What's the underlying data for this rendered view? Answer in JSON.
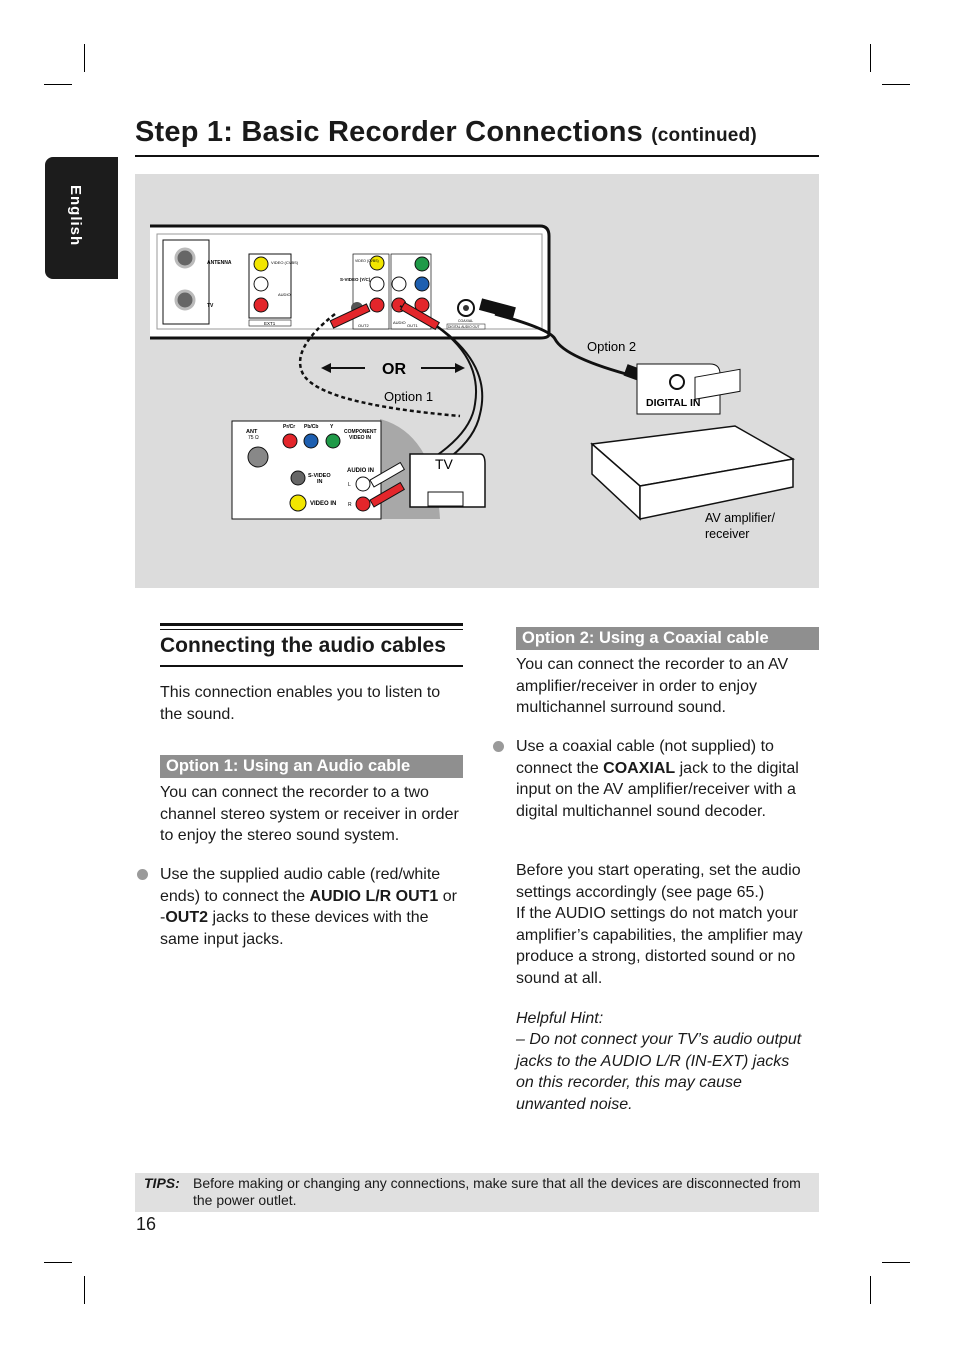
{
  "header": {
    "title": "Step 1: Basic Recorder Connections",
    "continued": "(continued)"
  },
  "language_tab": "English",
  "diagram": {
    "recorder_labels": {
      "antenna": "ANTENNA",
      "tv": "TV",
      "ext1": "EXT1",
      "ext1_video": "VIDEO (CVBS)",
      "ext1_audio": "AUDIO",
      "out2_video": "VIDEO (CVBS)",
      "svideo": "S-VIDEO (Y/C)",
      "out2": "OUT2",
      "audio": "AUDIO",
      "out1": "OUT1",
      "coaxial": "COAXIAL",
      "digital_audio_out": "DIGITAL AUDIO OUT"
    },
    "or_label": "OR",
    "option1_label": "Option 1",
    "option2_label": "Option 2",
    "digital_in_label": "DIGITAL IN",
    "tv_label": "TV",
    "tv_panel": {
      "ant": "ANT",
      "ohm": "75 Ω",
      "pr": "Pr/Cr",
      "pb": "Pb/Cb",
      "y": "Y",
      "component": "COMPONENT",
      "video_in_c": "VIDEO IN",
      "svideo_in": "S-VIDEO",
      "in": "IN",
      "audio_in": "AUDIO IN",
      "l": "L",
      "r": "R",
      "video_in": "VIDEO IN"
    },
    "amp_label_1": "AV amplifier/",
    "amp_label_2": "receiver",
    "colors": {
      "yellow": "#f2e600",
      "red": "#e3262b",
      "green": "#1f9a48",
      "blue": "#1e5fb0",
      "background": "#dcdcdc"
    }
  },
  "left": {
    "heading": "Connecting the audio cables",
    "intro": "This connection enables you to listen to the sound.",
    "option_bar": "Option 1: Using an Audio cable",
    "option_text": "You can connect the recorder to a two channel stereo system or receiver in order to enjoy the stereo sound system.",
    "bullet": {
      "p1": "Use the supplied audio cable (red/white ends) to connect the ",
      "b1": "AUDIO L/R OUT1",
      "p2": " or -",
      "b2": "OUT2",
      "p3": " jacks to these devices with the same input jacks."
    }
  },
  "right": {
    "option_bar": "Option 2: Using a Coaxial cable",
    "option_text": "You can connect the recorder to an AV amplifier/receiver in order to enjoy multichannel surround sound.",
    "bullet": {
      "p1": "Use a coaxial cable (not supplied) to connect the ",
      "b1": "COAXIAL",
      "p2": " jack to the digital input on the AV amplifier/receiver with a digital multichannel sound decoder."
    },
    "para1": "Before you start operating, set the audio settings accordingly (see page 65.)",
    "para2": "If the AUDIO settings do not match your amplifier’s capabilities, the amplifier may produce a strong, distorted sound or no sound at all.",
    "hint_title": "Helpful Hint:",
    "hint_text": "– Do not connect your TV’s audio output jacks to the AUDIO L/R (IN-EXT) jacks on this recorder, this may cause unwanted noise."
  },
  "tips": {
    "label": "TIPS:",
    "text": "Before making or changing any connections, make sure that all the devices are disconnected from the power outlet."
  },
  "page_number": "16"
}
